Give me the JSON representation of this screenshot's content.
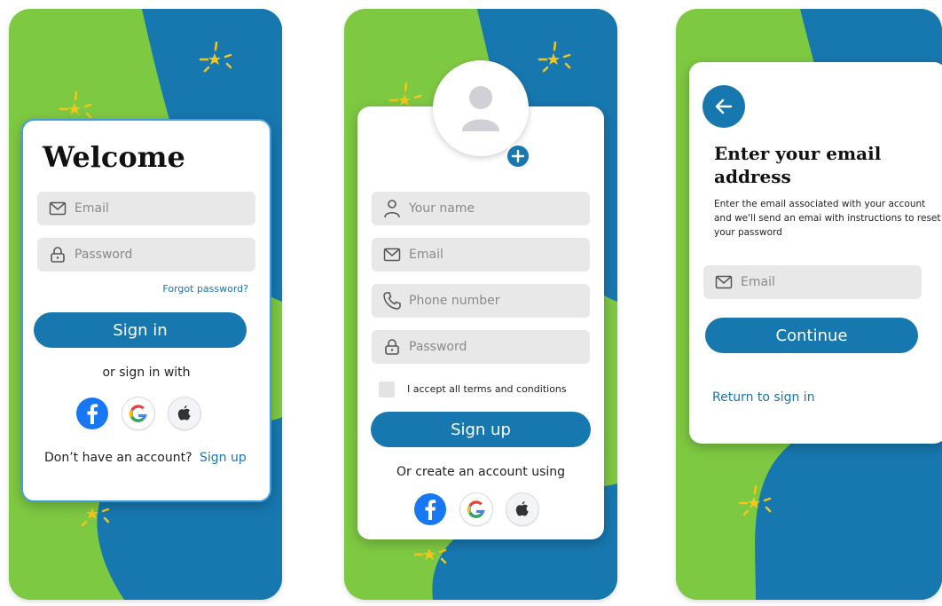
{
  "colors": {
    "green": "#7ec942",
    "blue": "#1778b0",
    "accent": "#1a73b0",
    "field": "#e8e8e8",
    "sparkle": "#f5c518"
  },
  "screen1": {
    "title": "Welcome",
    "email_placeholder": "Email",
    "password_placeholder": "Password",
    "forgot_label": "Forgot password?",
    "signin_label": "Sign in",
    "or_label": "or sign in with",
    "no_account_label": "Don’t have an account?",
    "signup_link": "Sign up",
    "social_icons": [
      "facebook-icon",
      "google-icon",
      "apple-icon"
    ]
  },
  "screen2": {
    "name_placeholder": "Your name",
    "email_placeholder": "Email",
    "phone_placeholder": "Phone number",
    "password_placeholder": "Password",
    "terms_label": "I accept all terms and conditions",
    "signup_label": "Sign up",
    "or_label": "Or create an account using",
    "social_icons": [
      "facebook-icon",
      "google-icon",
      "apple-icon"
    ]
  },
  "screen3": {
    "title": "Enter your email address",
    "description": "Enter the email associated with your account and we'll send an emai with instructions to reset your password",
    "email_placeholder": "Email",
    "continue_label": "Continue",
    "return_label": "Return to sign in"
  }
}
